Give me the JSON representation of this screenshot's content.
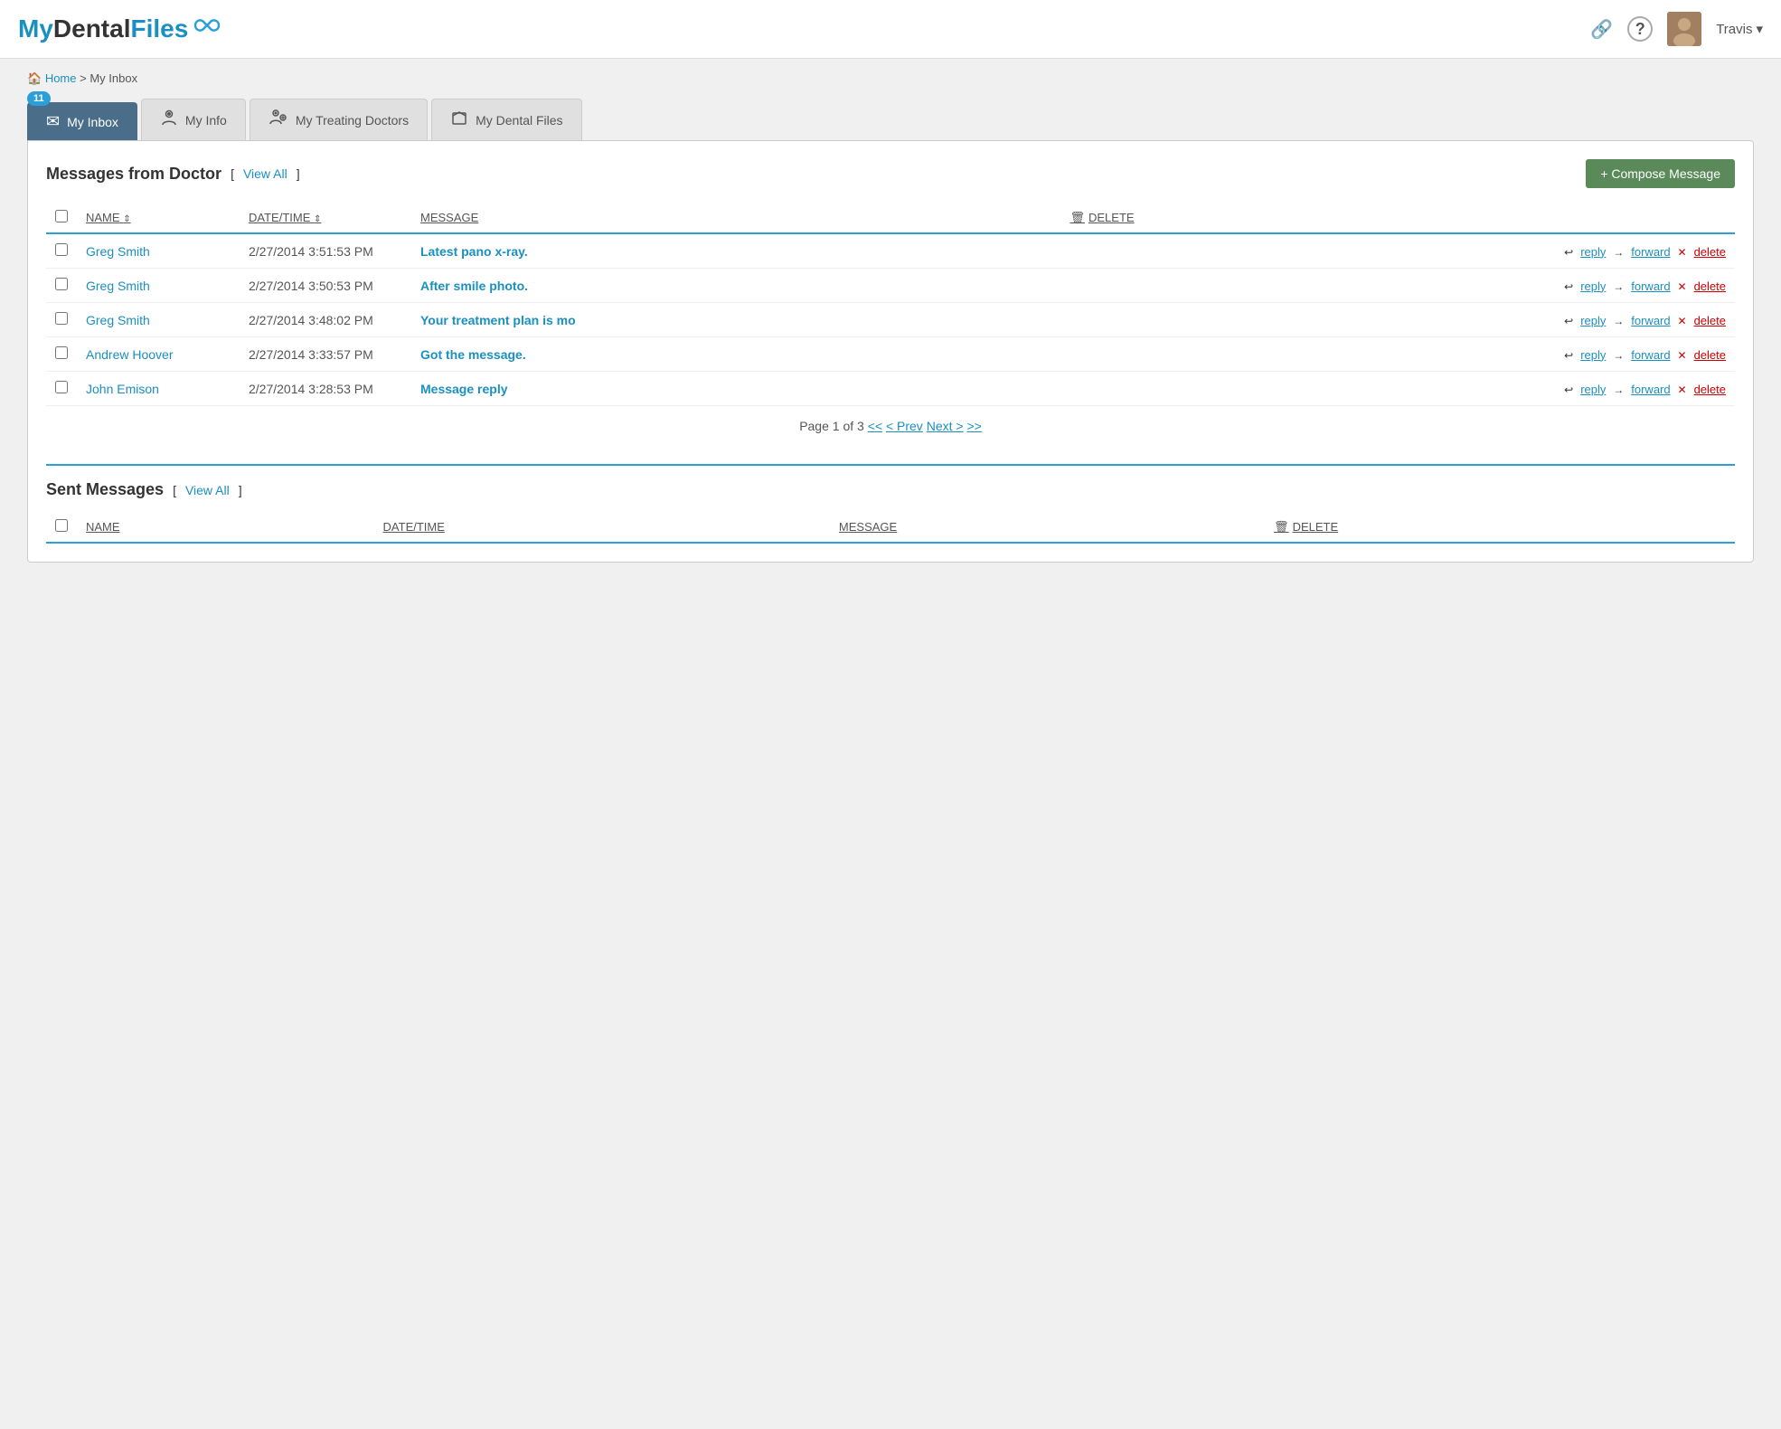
{
  "logo": {
    "my": "My",
    "dental": "Dental",
    "files": "Files"
  },
  "header": {
    "user_name": "Travis",
    "help_icon": "?",
    "link_icon": "🔗"
  },
  "breadcrumb": {
    "home": "Home",
    "separator": ">",
    "current": "My Inbox"
  },
  "badge": {
    "count": "11"
  },
  "tabs": [
    {
      "id": "inbox",
      "label": "My Inbox",
      "icon": "✉",
      "active": true
    },
    {
      "id": "info",
      "label": "My Info",
      "icon": "👤",
      "active": false
    },
    {
      "id": "doctors",
      "label": "My Treating Doctors",
      "icon": "👨‍⚕",
      "active": false
    },
    {
      "id": "files",
      "label": "My Dental Files",
      "icon": "📁",
      "active": false
    }
  ],
  "messages_section": {
    "title": "Messages from Doctor",
    "view_all": "View All",
    "compose_btn": "+ Compose Message",
    "columns": {
      "name": "NAME",
      "datetime": "DATE/TIME",
      "message": "MESSAGE",
      "delete": "DELETE"
    },
    "rows": [
      {
        "sender": "Greg Smith",
        "datetime": "2/27/2014 3:51:53 PM",
        "message": "Latest pano x-ray."
      },
      {
        "sender": "Greg Smith",
        "datetime": "2/27/2014 3:50:53 PM",
        "message": "After smile photo."
      },
      {
        "sender": "Greg Smith",
        "datetime": "2/27/2014 3:48:02 PM",
        "message": "Your treatment plan is mo"
      },
      {
        "sender": "Andrew Hoover",
        "datetime": "2/27/2014 3:33:57 PM",
        "message": "Got the message."
      },
      {
        "sender": "John Emison",
        "datetime": "2/27/2014 3:28:53 PM",
        "message": "Message reply"
      }
    ],
    "actions": {
      "reply": "reply",
      "forward": "forward",
      "delete": "delete"
    },
    "pagination": {
      "text": "Page 1 of 3",
      "first": "<<",
      "prev": "< Prev",
      "next": "Next >",
      "last": ">>"
    }
  },
  "sent_section": {
    "title": "Sent Messages",
    "view_all": "View All",
    "columns": {
      "name": "NAME",
      "datetime": "DATE/TIME",
      "message": "MESSAGE",
      "delete": "DELETE"
    }
  }
}
